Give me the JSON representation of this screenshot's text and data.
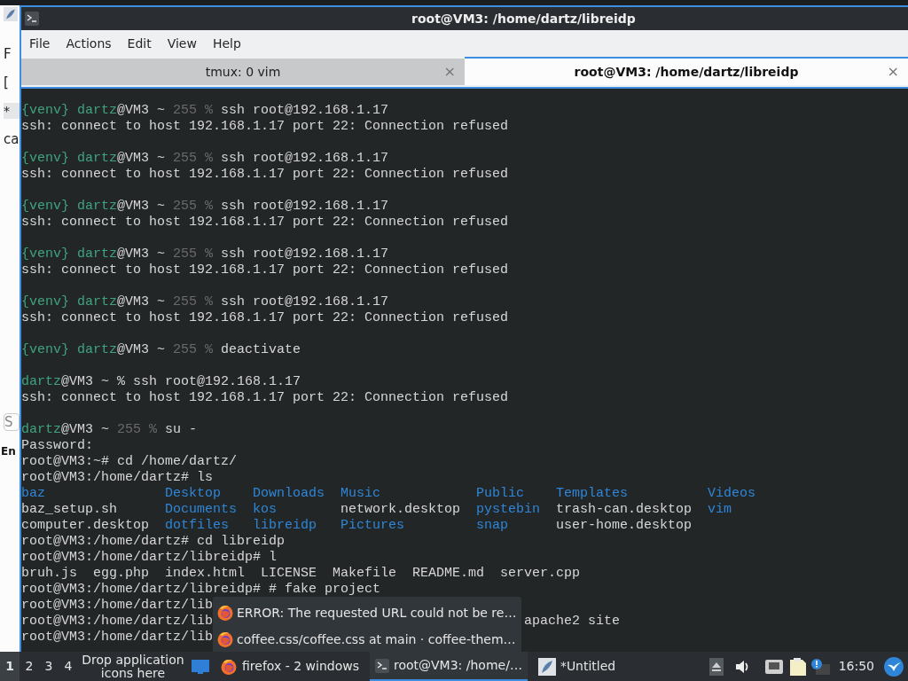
{
  "background_window": {
    "fragments": [
      {
        "text": "F",
        "kind": "menu"
      },
      {
        "text": "[",
        "kind": "plain"
      },
      {
        "text": "*",
        "kind": "tab"
      },
      {
        "text": "ca",
        "kind": "plain"
      },
      {
        "text": "S",
        "kind": "field"
      },
      {
        "text": "En",
        "kind": "bold"
      }
    ]
  },
  "window": {
    "title": "root@VM3: /home/dartz/libreidp"
  },
  "menu": [
    "File",
    "Actions",
    "Edit",
    "View",
    "Help"
  ],
  "tabs": [
    {
      "label": "tmux: 0 vim",
      "close": "×",
      "selected": false
    },
    {
      "label": "root@VM3: /home/dartz/libreidp",
      "close": "×",
      "selected": true
    }
  ],
  "terminal": {
    "lines": [
      {
        "kind": "text",
        "segments": [
          {
            "kind": "green",
            "text": "{venv} "
          },
          {
            "kind": "green",
            "text": "dartz"
          },
          {
            "kind": "plain",
            "text": "@VM3 ~ "
          },
          {
            "kind": "dim",
            "text": "255 %"
          },
          {
            "kind": "plain",
            "text": " ssh root@192.168.1.17"
          }
        ]
      },
      {
        "kind": "text",
        "segments": [
          {
            "kind": "plain",
            "text": "ssh: connect to host 192.168.1.17 port 22: Connection refused"
          }
        ]
      },
      {
        "kind": "blank"
      },
      {
        "kind": "text",
        "segments": [
          {
            "kind": "green",
            "text": "{venv} "
          },
          {
            "kind": "green",
            "text": "dartz"
          },
          {
            "kind": "plain",
            "text": "@VM3 ~ "
          },
          {
            "kind": "dim",
            "text": "255 %"
          },
          {
            "kind": "plain",
            "text": " ssh root@192.168.1.17"
          }
        ]
      },
      {
        "kind": "text",
        "segments": [
          {
            "kind": "plain",
            "text": "ssh: connect to host 192.168.1.17 port 22: Connection refused"
          }
        ]
      },
      {
        "kind": "blank"
      },
      {
        "kind": "text",
        "segments": [
          {
            "kind": "green",
            "text": "{venv} "
          },
          {
            "kind": "green",
            "text": "dartz"
          },
          {
            "kind": "plain",
            "text": "@VM3 ~ "
          },
          {
            "kind": "dim",
            "text": "255 %"
          },
          {
            "kind": "plain",
            "text": " ssh root@192.168.1.17"
          }
        ]
      },
      {
        "kind": "text",
        "segments": [
          {
            "kind": "plain",
            "text": "ssh: connect to host 192.168.1.17 port 22: Connection refused"
          }
        ]
      },
      {
        "kind": "blank"
      },
      {
        "kind": "text",
        "segments": [
          {
            "kind": "green",
            "text": "{venv} "
          },
          {
            "kind": "green",
            "text": "dartz"
          },
          {
            "kind": "plain",
            "text": "@VM3 ~ "
          },
          {
            "kind": "dim",
            "text": "255 %"
          },
          {
            "kind": "plain",
            "text": " ssh root@192.168.1.17"
          }
        ]
      },
      {
        "kind": "text",
        "segments": [
          {
            "kind": "plain",
            "text": "ssh: connect to host 192.168.1.17 port 22: Connection refused"
          }
        ]
      },
      {
        "kind": "blank"
      },
      {
        "kind": "text",
        "segments": [
          {
            "kind": "green",
            "text": "{venv} "
          },
          {
            "kind": "green",
            "text": "dartz"
          },
          {
            "kind": "plain",
            "text": "@VM3 ~ "
          },
          {
            "kind": "dim",
            "text": "255 %"
          },
          {
            "kind": "plain",
            "text": " ssh root@192.168.1.17"
          }
        ]
      },
      {
        "kind": "text",
        "segments": [
          {
            "kind": "plain",
            "text": "ssh: connect to host 192.168.1.17 port 22: Connection refused"
          }
        ]
      },
      {
        "kind": "blank"
      },
      {
        "kind": "text",
        "segments": [
          {
            "kind": "green",
            "text": "{venv} "
          },
          {
            "kind": "green",
            "text": "dartz"
          },
          {
            "kind": "plain",
            "text": "@VM3 ~ "
          },
          {
            "kind": "dim",
            "text": "255 %"
          },
          {
            "kind": "plain",
            "text": " deactivate"
          }
        ]
      },
      {
        "kind": "blank"
      },
      {
        "kind": "text",
        "segments": [
          {
            "kind": "green",
            "text": "dartz"
          },
          {
            "kind": "plain",
            "text": "@VM3 ~ % ssh root@192.168.1.17"
          }
        ]
      },
      {
        "kind": "text",
        "segments": [
          {
            "kind": "plain",
            "text": "ssh: connect to host 192.168.1.17 port 22: Connection refused"
          }
        ]
      },
      {
        "kind": "blank"
      },
      {
        "kind": "text",
        "segments": [
          {
            "kind": "green",
            "text": "dartz"
          },
          {
            "kind": "plain",
            "text": "@VM3 ~ "
          },
          {
            "kind": "dim",
            "text": "255 %"
          },
          {
            "kind": "plain",
            "text": " su -"
          }
        ]
      },
      {
        "kind": "text",
        "segments": [
          {
            "kind": "plain",
            "text": "Password:"
          }
        ]
      },
      {
        "kind": "text",
        "segments": [
          {
            "kind": "plain",
            "text": "root@VM3:~# cd /home/dartz/"
          }
        ]
      },
      {
        "kind": "text",
        "segments": [
          {
            "kind": "plain",
            "text": "root@VM3:/home/dartz# ls"
          }
        ]
      },
      {
        "kind": "columns",
        "cells": [
          {
            "kind": "dir",
            "text": "baz"
          },
          {
            "kind": "dir",
            "text": "Desktop"
          },
          {
            "kind": "dir",
            "text": "Downloads"
          },
          {
            "kind": "dir",
            "text": "Music"
          },
          {
            "kind": "dir",
            "text": "Public"
          },
          {
            "kind": "dir",
            "text": "Templates"
          },
          {
            "kind": "dir",
            "text": "Videos"
          }
        ]
      },
      {
        "kind": "columns",
        "cells": [
          {
            "kind": "plain",
            "text": "baz_setup.sh"
          },
          {
            "kind": "dir",
            "text": "Documents"
          },
          {
            "kind": "dir",
            "text": "kos"
          },
          {
            "kind": "plain",
            "text": "network.desktop"
          },
          {
            "kind": "dir",
            "text": "pystebin"
          },
          {
            "kind": "plain",
            "text": "trash-can.desktop"
          },
          {
            "kind": "dir",
            "text": "vim"
          }
        ]
      },
      {
        "kind": "columns",
        "cells": [
          {
            "kind": "plain",
            "text": "computer.desktop"
          },
          {
            "kind": "dir",
            "text": "dotfiles"
          },
          {
            "kind": "dir",
            "text": "libreidp"
          },
          {
            "kind": "dir",
            "text": "Pictures"
          },
          {
            "kind": "dir",
            "text": "snap"
          },
          {
            "kind": "plain",
            "text": "user-home.desktop"
          }
        ]
      },
      {
        "kind": "text",
        "segments": [
          {
            "kind": "plain",
            "text": "root@VM3:/home/dartz# cd libreidp"
          }
        ]
      },
      {
        "kind": "text",
        "segments": [
          {
            "kind": "plain",
            "text": "root@VM3:/home/dartz/libreidp# l"
          }
        ]
      },
      {
        "kind": "text",
        "segments": [
          {
            "kind": "plain",
            "text": "bruh.js  egg.php  index.html  LICENSE  Makefile  README.md  server.cpp"
          }
        ]
      },
      {
        "kind": "text",
        "segments": [
          {
            "kind": "plain",
            "text": "root@VM3:/home/dartz/libreidp# # fake project"
          }
        ]
      },
      {
        "kind": "covered",
        "left": "root@VM3:/home/dartz/lib"
      },
      {
        "kind": "covered",
        "left": "root@VM3:/home/dartz/lib",
        "right": "apache2 site"
      },
      {
        "kind": "covered",
        "left": "root@VM3:/home/dartz/lib"
      }
    ]
  },
  "popup": {
    "items": [
      "ERROR: The requested URL could not be re…",
      "coffee.css/coffee.css at main · coffee-them…"
    ]
  },
  "taskbar": {
    "desktops": [
      {
        "label": "1",
        "selected": true
      },
      {
        "label": "2",
        "selected": false
      },
      {
        "label": "3",
        "selected": false
      },
      {
        "label": "4",
        "selected": false
      }
    ],
    "launcher_hint": "Drop application icons here",
    "tasks": [
      {
        "kind": "firefox",
        "label": "firefox - 2 windows",
        "selected": false
      },
      {
        "kind": "terminal",
        "label": "root@VM3: /home/…",
        "selected": true
      },
      {
        "kind": "editor",
        "label": "*Untitled",
        "selected": false
      }
    ],
    "clock": "16:50"
  }
}
